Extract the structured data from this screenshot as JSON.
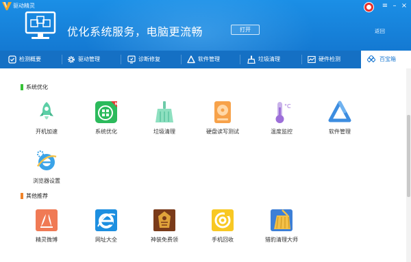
{
  "app": {
    "title": "驱动精灵",
    "brand_color": "#1479d2"
  },
  "header": {
    "headline": "优化系统服务，电脑更流畅",
    "open_button": "打开",
    "back_link": "返回"
  },
  "window_controls": [
    "≡",
    "–",
    "×"
  ],
  "tabs": [
    {
      "label": "检测概要",
      "icon": "monitor-check-icon"
    },
    {
      "label": "驱动管理",
      "icon": "gear-icon"
    },
    {
      "label": "诊断修复",
      "icon": "repair-icon"
    },
    {
      "label": "软件管理",
      "icon": "triangle-logo-icon"
    },
    {
      "label": "垃圾清理",
      "icon": "broom-icon"
    },
    {
      "label": "硬件检测",
      "icon": "chart-icon"
    },
    {
      "label": "百宝箱",
      "icon": "toolbox-icon",
      "active": true
    }
  ],
  "sections": [
    {
      "title": "系统优化",
      "color": "#36c236",
      "tools": [
        {
          "label": "开机加速",
          "icon": "rocket-icon"
        },
        {
          "label": "系统优化",
          "icon": "windows-optimize-icon",
          "badge": "N"
        },
        {
          "label": "垃圾清理",
          "icon": "broom-icon"
        },
        {
          "label": "硬盘读写测试",
          "icon": "hard-disk-icon"
        },
        {
          "label": "温度监控",
          "icon": "thermometer-icon",
          "unit": "°C"
        },
        {
          "label": "软件管理",
          "icon": "triangle-logo-icon"
        },
        {
          "label": "浏览器设置",
          "icon": "ie-gear-icon"
        }
      ]
    },
    {
      "title": "其他推荐",
      "color": "#f0832a",
      "tools": [
        {
          "label": "精灵微博",
          "icon": "weibo-icon"
        },
        {
          "label": "网址大全",
          "icon": "ie-icon"
        },
        {
          "label": "神装免费领",
          "icon": "game-armor-icon"
        },
        {
          "label": "手机回收",
          "icon": "recycle-icon"
        },
        {
          "label": "猎豹清理大师",
          "icon": "cleaner-broom-icon"
        }
      ]
    }
  ]
}
